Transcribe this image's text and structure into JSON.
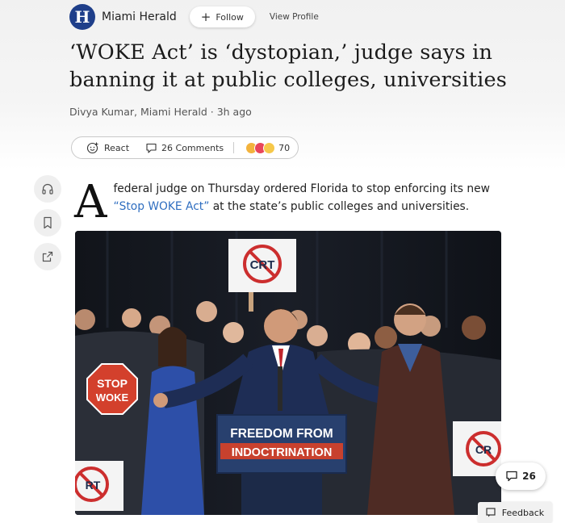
{
  "publisher": {
    "logo_letter": "H",
    "name": "Miami Herald",
    "follow_label": "Follow",
    "view_profile_label": "View Profile"
  },
  "article": {
    "headline": "‘WOKE Act’ is ‘dystopian,’ judge says in banning it at public colleges, universities",
    "byline": "Divya Kumar, Miami Herald · 3h ago",
    "lede_dropcap": "A",
    "lede_text_before": "federal judge on Thursday ordered Florida to stop enforcing its new ",
    "lede_link": "“Stop WOKE Act”",
    "lede_text_after": " at the state’s public colleges and universities."
  },
  "engagement": {
    "react_label": "React",
    "comments_label": "26 Comments",
    "reaction_count": "70"
  },
  "photo": {
    "signs": {
      "crt_top": "CRT",
      "stop": "STOP",
      "woke": "WOKE",
      "podium_line1": "FREEDOM FROM",
      "podium_line2": "INDOCTRINATION",
      "crt_right": "CR",
      "crt_left": "RT"
    }
  },
  "floating": {
    "comment_count": "26",
    "feedback_label": "Feedback"
  },
  "colors": {
    "link": "#2f6ec0",
    "logo_bg": "#1f3f8a",
    "podium_blue": "#28406e",
    "stop_red": "#d3402c"
  }
}
